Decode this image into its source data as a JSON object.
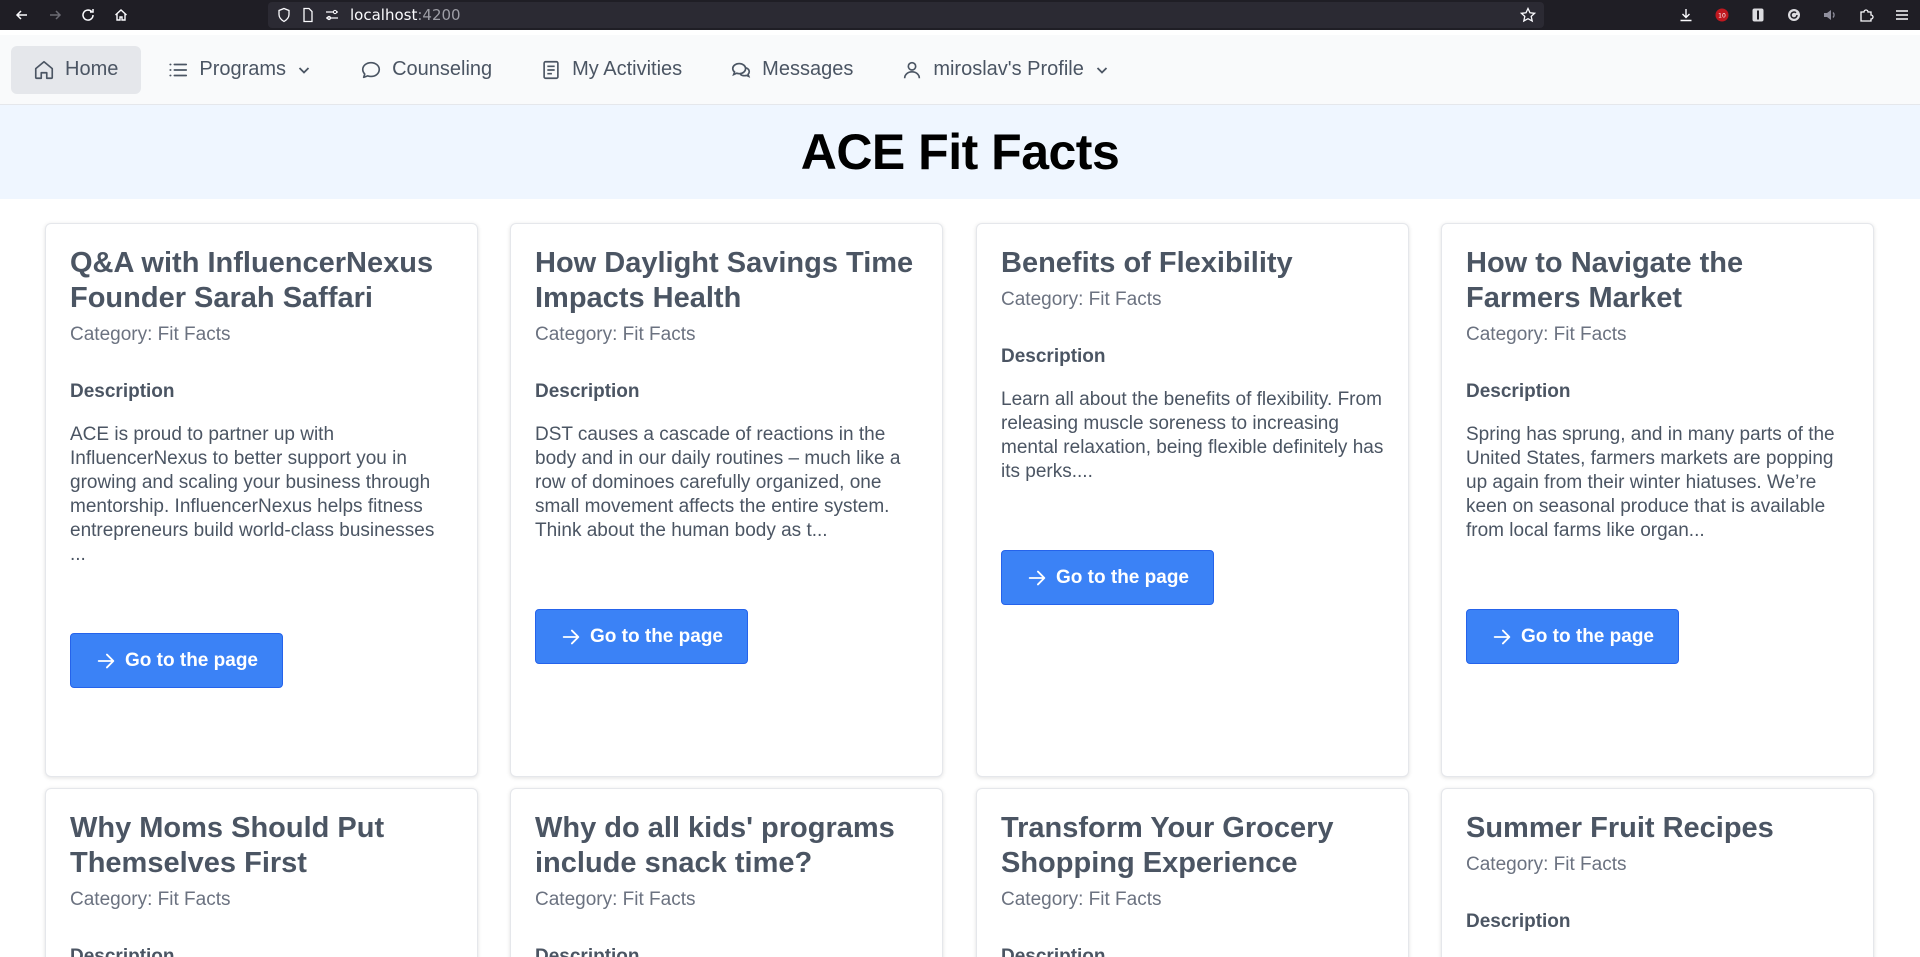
{
  "browser": {
    "url_host": "localhost",
    "url_port": ":4200"
  },
  "nav": {
    "items": [
      {
        "label": "Home",
        "icon": "home-icon"
      },
      {
        "label": "Programs",
        "icon": "list-icon"
      },
      {
        "label": "Counseling",
        "icon": "chat-icon"
      },
      {
        "label": "My Activities",
        "icon": "document-icon"
      },
      {
        "label": "Messages",
        "icon": "messages-icon"
      },
      {
        "label": "miroslav's Profile",
        "icon": "user-icon"
      }
    ]
  },
  "page": {
    "title": "ACE Fit Facts"
  },
  "cards": [
    {
      "title": "Q&A with InfluencerNexus Founder Sarah Saffari",
      "category": "Category: Fit Facts",
      "description_heading": "Description",
      "description": "ACE is proud to partner up with InfluencerNexus to better support you in growing and scaling your business through mentorship. InfluencerNexus helps fitness entrepreneurs build world-class businesses ...",
      "button": "Go to the page"
    },
    {
      "title": "How Daylight Savings Time Impacts Health",
      "category": "Category: Fit Facts",
      "description_heading": "Description",
      "description": "DST causes a cascade of reactions in the body and in our daily routines – much like a row of dominoes carefully organized, one small movement affects the entire system. Think about the human body as t...",
      "button": "Go to the page"
    },
    {
      "title": "Benefits of Flexibility",
      "category": "Category: Fit Facts",
      "description_heading": "Description",
      "description": "Learn all about the benefits of flexibility. From releasing muscle soreness to increasing mental relaxation, being flexible definitely has its perks....",
      "button": "Go to the page"
    },
    {
      "title": "How to Navigate the Farmers Market",
      "category": "Category: Fit Facts",
      "description_heading": "Description",
      "description": "Spring has sprung, and in many parts of the United States, farmers markets are popping up again from their winter hiatuses. We’re keen on seasonal produce that is available from local farms like organ...",
      "button": "Go to the page"
    },
    {
      "title": "Why Moms Should Put Themselves First",
      "category": "Category: Fit Facts",
      "description_heading": "Description"
    },
    {
      "title": "Why do all kids' programs include snack time?",
      "category": "Category: Fit Facts",
      "description_heading": "Description"
    },
    {
      "title": "Transform Your Grocery Shopping Experience",
      "category": "Category: Fit Facts",
      "description_heading": "Description"
    },
    {
      "title": "Summer Fruit Recipes",
      "category": "Category: Fit Facts",
      "description_heading": "Description"
    }
  ],
  "colors": {
    "accent": "#3b82f6",
    "banner_bg": "#eff6ff",
    "nav_bg": "#f9fafb"
  }
}
